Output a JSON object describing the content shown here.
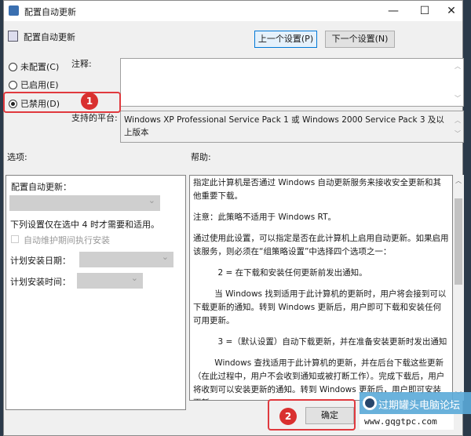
{
  "window": {
    "title": "配置自动更新",
    "controls": [
      "minimize",
      "maximize",
      "close"
    ]
  },
  "header": {
    "policy_name": "配置自动更新",
    "prev_button": "上一个设置(P)",
    "next_button": "下一个设置(N)"
  },
  "state": {
    "options": [
      {
        "label": "未配置(C)",
        "checked": false
      },
      {
        "label": "已启用(E)",
        "checked": false
      },
      {
        "label": "已禁用(D)",
        "checked": true
      }
    ]
  },
  "comment": {
    "label": "注释:",
    "value": ""
  },
  "platform": {
    "label": "支持的平台:",
    "value": "Windows XP Professional Service Pack 1 或 Windows 2000 Service Pack 3 及以上版本"
  },
  "options_section": {
    "label": "选项:",
    "configure_label": "配置自动更新：",
    "configure_value": "",
    "note": "下列设置仅在选中 4 时才需要和适用。",
    "maintenance_checkbox": "自动维护期间执行安装",
    "install_day_label": "计划安装日期：",
    "install_time_label": "计划安装时间："
  },
  "help_section": {
    "label": "帮助:",
    "paragraphs": [
      "指定此计算机是否通过 Windows 自动更新服务来接收安全更新和其他重要下载。",
      "注意：此策略不适用于 Windows RT。",
      "通过使用此设置，可以指定是否在此计算机上启用自动更新。如果启用该服务，则必须在“组策略设置”中选择四个选项之一：",
      "2 = 在下载和安装任何更新前发出通知。",
      "当 Windows 找到适用于此计算机的更新时，用户将会接到可以下载更新的通知。转到 Windows 更新后，用户即可下载和安装任何可用更新。",
      "3 =（默认设置）自动下载更新，并在准备安装更新时发出通知",
      "Windows 查找适用于此计算机的更新，并在后台下载这些更新（在此过程中，用户不会收到通知或被打断工作）。完成下载后，用户将收到可以安装更新的通知。转到 Windows 更新后，用户即可安装更新。"
    ]
  },
  "footer": {
    "ok_button": "确定"
  },
  "annotations": {
    "badge1": "1",
    "badge2": "2",
    "color": "#e0393e"
  },
  "watermark": {
    "name": "过期罐头电脑论坛",
    "url": "www.gqgtpc.com"
  }
}
